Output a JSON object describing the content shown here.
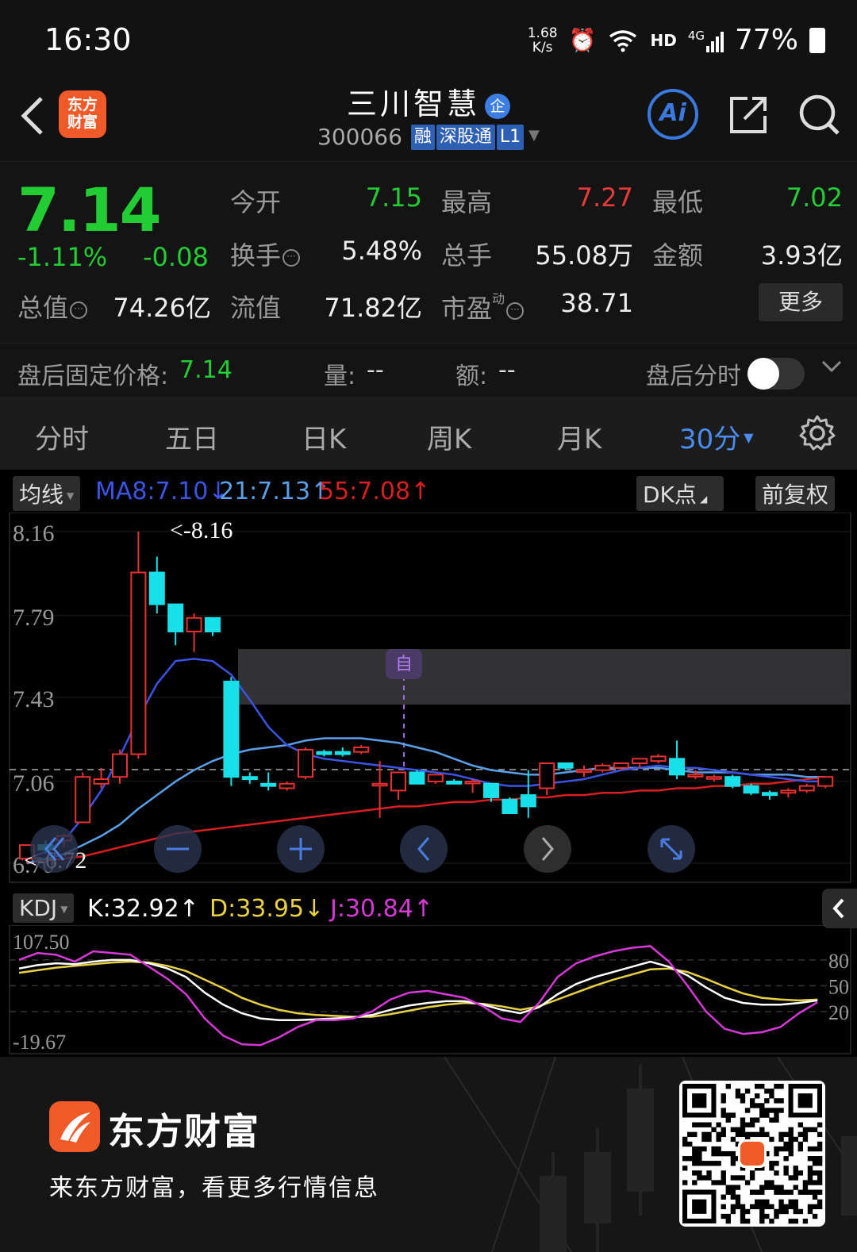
{
  "status_bar": {
    "time": "16:30",
    "net_speed_value": "1.68",
    "net_speed_unit": "K/s",
    "hd": "HD",
    "signal": "4G",
    "battery": "77%"
  },
  "header": {
    "logo_text": "东方财富",
    "stock_name": "三川智慧",
    "badge": "企",
    "code": "300066",
    "tags": [
      "融",
      "深股通",
      "L1"
    ],
    "ai_label": "Ai"
  },
  "quote": {
    "price": "7.14",
    "change_pct": "-1.11%",
    "change": "-0.08",
    "fields": {
      "open_label": "今开",
      "open": "7.15",
      "high_label": "最高",
      "high": "7.27",
      "low_label": "最低",
      "low": "7.02",
      "turnover_label": "换手",
      "turnover": "5.48%",
      "volume_label": "总手",
      "volume": "55.08万",
      "amount_label": "金额",
      "amount": "3.93亿",
      "mktcap_label": "总值",
      "mktcap": "74.26亿",
      "float_label": "流值",
      "float": "71.82亿",
      "pe_label": "市盈",
      "pe_sup": "动",
      "pe": "38.71"
    },
    "more_label": "更多",
    "after_hours": {
      "price_label": "盘后固定价格:",
      "price": "7.14",
      "vol_label": "量:",
      "vol": "--",
      "amt_label": "额:",
      "amt": "--",
      "timeshare_label": "盘后分时",
      "toggle_on": false
    }
  },
  "tabs": [
    "分时",
    "五日",
    "日K",
    "周K",
    "月K",
    "30分"
  ],
  "active_tab": "30分",
  "chart": {
    "ma_dropdown": "均线",
    "ma8": "MA8:7.10↓",
    "ma21": "21:7.13↑",
    "ma55": "55:7.08↑",
    "dk_button": "DK点",
    "adjust_button": "前复权",
    "y_labels": [
      "8.16",
      "7.79",
      "7.43",
      "7.06",
      "6.70"
    ],
    "high_marker": "<-8.16",
    "low_marker": "<-6.72",
    "self_marker": "自",
    "kdj_dropdown": "KDJ",
    "kdj_k": "K:32.92↑",
    "kdj_d": "D:33.95↓",
    "kdj_j": "J:30.84↑",
    "kdj_top": "107.50",
    "kdj_bottom": "-19.67",
    "kdj_levels": [
      "80",
      "50",
      "20"
    ],
    "colors": {
      "up": "#e8312e",
      "down": "#18e0e8",
      "ma8": "#3a55e6",
      "ma21": "#5aa0e8",
      "ma55": "#d81e1e",
      "k": "#ffffff",
      "d": "#e8d040",
      "j": "#d838d8"
    }
  },
  "chart_data": {
    "type": "candlestick",
    "period": "30分",
    "price_axis": [
      6.7,
      8.16
    ],
    "candles": [
      [
        6.72,
        6.78,
        6.7,
        6.78
      ],
      [
        6.78,
        6.8,
        6.74,
        6.76
      ],
      [
        6.8,
        6.83,
        6.77,
        6.82
      ],
      [
        6.88,
        7.1,
        6.88,
        7.08
      ],
      [
        7.05,
        7.12,
        7.03,
        7.07
      ],
      [
        7.08,
        7.2,
        7.05,
        7.18
      ],
      [
        7.18,
        8.16,
        7.16,
        7.98
      ],
      [
        7.98,
        8.05,
        7.8,
        7.84
      ],
      [
        7.84,
        7.84,
        7.66,
        7.72
      ],
      [
        7.72,
        7.8,
        7.63,
        7.78
      ],
      [
        7.78,
        7.78,
        7.7,
        7.72
      ],
      [
        7.5,
        7.52,
        7.04,
        7.08
      ],
      [
        7.08,
        7.1,
        7.05,
        7.07
      ],
      [
        7.05,
        7.1,
        7.02,
        7.04
      ],
      [
        7.03,
        7.06,
        7.02,
        7.05
      ],
      [
        7.08,
        7.21,
        7.07,
        7.2
      ],
      [
        7.19,
        7.2,
        7.17,
        7.18
      ],
      [
        7.19,
        7.21,
        7.17,
        7.18
      ],
      [
        7.19,
        7.22,
        7.18,
        7.21
      ],
      [
        7.05,
        7.15,
        6.9,
        7.05
      ],
      [
        7.02,
        7.09,
        6.98,
        7.1
      ],
      [
        7.1,
        7.11,
        7.05,
        7.05
      ],
      [
        7.06,
        7.09,
        7.05,
        7.09
      ],
      [
        7.06,
        7.07,
        7.05,
        7.05
      ],
      [
        7.06,
        7.07,
        7.01,
        7.06
      ],
      [
        7.05,
        7.05,
        6.97,
        6.99
      ],
      [
        6.98,
        6.99,
        6.92,
        6.92
      ],
      [
        7.0,
        7.11,
        6.9,
        6.95
      ],
      [
        7.03,
        7.14,
        7.0,
        7.14
      ],
      [
        7.14,
        7.14,
        7.11,
        7.12
      ],
      [
        7.11,
        7.13,
        7.08,
        7.11
      ],
      [
        7.11,
        7.14,
        7.1,
        7.13
      ],
      [
        7.12,
        7.14,
        7.11,
        7.14
      ],
      [
        7.14,
        7.16,
        7.12,
        7.16
      ],
      [
        7.15,
        7.18,
        7.14,
        7.17
      ],
      [
        7.16,
        7.24,
        7.07,
        7.09
      ],
      [
        7.09,
        7.11,
        7.07,
        7.09
      ],
      [
        7.08,
        7.09,
        7.06,
        7.08
      ],
      [
        7.08,
        7.09,
        7.03,
        7.04
      ],
      [
        7.04,
        7.05,
        7.0,
        7.01
      ],
      [
        7.01,
        7.02,
        6.98,
        7.0
      ],
      [
        7.01,
        7.03,
        6.99,
        7.02
      ],
      [
        7.02,
        7.05,
        7.01,
        7.04
      ],
      [
        7.04,
        7.08,
        7.03,
        7.08
      ]
    ],
    "ma8": [
      6.72,
      6.75,
      6.8,
      6.9,
      7.02,
      7.17,
      7.34,
      7.49,
      7.59,
      7.6,
      7.59,
      7.53,
      7.42,
      7.3,
      7.22,
      7.18,
      7.16,
      7.15,
      7.14,
      7.13,
      7.12,
      7.11,
      7.1,
      7.09,
      7.07,
      7.05,
      7.04,
      7.04,
      7.05,
      7.06,
      7.07,
      7.09,
      7.11,
      7.12,
      7.13,
      7.12,
      7.12,
      7.11,
      7.1,
      7.09,
      7.08,
      7.07,
      7.06,
      7.06
    ],
    "ma21": [
      6.7,
      6.72,
      6.74,
      6.78,
      6.82,
      6.87,
      6.94,
      7.0,
      7.06,
      7.11,
      7.15,
      7.18,
      7.2,
      7.21,
      7.22,
      7.24,
      7.25,
      7.25,
      7.25,
      7.24,
      7.23,
      7.21,
      7.19,
      7.16,
      7.13,
      7.11,
      7.1,
      7.09,
      7.09,
      7.1,
      7.11,
      7.12,
      7.12,
      7.12,
      7.12,
      7.11,
      7.1,
      7.1,
      7.1,
      7.09,
      7.09,
      7.09,
      7.08,
      7.08
    ],
    "ma55": [
      6.7,
      6.71,
      6.72,
      6.73,
      6.75,
      6.77,
      6.79,
      6.81,
      6.83,
      6.84,
      6.85,
      6.86,
      6.87,
      6.88,
      6.89,
      6.9,
      6.91,
      6.92,
      6.93,
      6.94,
      6.95,
      6.95,
      6.96,
      6.97,
      6.97,
      6.98,
      6.98,
      6.99,
      6.99,
      7.0,
      7.0,
      7.01,
      7.01,
      7.02,
      7.02,
      7.03,
      7.03,
      7.04,
      7.04,
      7.05,
      7.05,
      7.06,
      7.07,
      7.08
    ],
    "kdj_axis": [
      -19.67,
      107.5
    ],
    "k": [
      70,
      74,
      76,
      75,
      78,
      80,
      80,
      76,
      70,
      60,
      42,
      28,
      18,
      12,
      10,
      10,
      11,
      12,
      13,
      16,
      22,
      27,
      30,
      32,
      32,
      28,
      22,
      18,
      25,
      40,
      52,
      60,
      66,
      72,
      78,
      72,
      62,
      48,
      36,
      30,
      28,
      28,
      30,
      32.92
    ],
    "d": [
      65,
      68,
      71,
      73,
      75,
      77,
      78,
      77,
      73,
      67,
      57,
      47,
      36,
      28,
      22,
      18,
      16,
      15,
      14,
      14,
      17,
      21,
      25,
      28,
      30,
      29,
      26,
      22,
      26,
      34,
      42,
      50,
      57,
      63,
      69,
      70,
      66,
      58,
      49,
      41,
      36,
      34,
      33,
      33.95
    ],
    "j": [
      80,
      88,
      86,
      78,
      90,
      88,
      86,
      72,
      58,
      40,
      12,
      -8,
      -18,
      -19,
      -10,
      2,
      10,
      10,
      12,
      20,
      34,
      42,
      44,
      40,
      36,
      26,
      12,
      8,
      30,
      60,
      76,
      84,
      90,
      94,
      96,
      78,
      50,
      20,
      0,
      -6,
      -4,
      2,
      18,
      30.84
    ]
  }
}
